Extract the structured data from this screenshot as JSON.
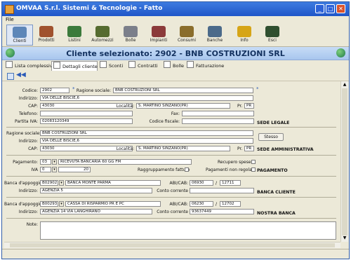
{
  "window": {
    "title": "OMVAA S.r.l. Sistemi & Tecnologie - Fatto"
  },
  "menu": {
    "file": "File"
  },
  "toolbar": {
    "items": [
      {
        "label": "Clienti",
        "icon": "clients-icon",
        "color": "#5d86b8"
      },
      {
        "label": "Prodotti",
        "icon": "products-icon",
        "color": "#a0522d"
      },
      {
        "label": "Listini",
        "icon": "price-lists-icon",
        "color": "#3b7a3b"
      },
      {
        "label": "Automezzi",
        "icon": "vehicles-icon",
        "color": "#556b2f"
      },
      {
        "label": "Bolle",
        "icon": "delivery-notes-icon",
        "color": "#7b7f8a"
      },
      {
        "label": "Impianti",
        "icon": "plants-icon",
        "color": "#8b3a3a"
      },
      {
        "label": "Consumi",
        "icon": "consumption-icon",
        "color": "#8a6d2b"
      },
      {
        "label": "Banche",
        "icon": "banks-icon",
        "color": "#4b6a8a"
      },
      {
        "label": "Info",
        "icon": "help-icon",
        "color": "#d6a517"
      },
      {
        "label": "Esci",
        "icon": "exit-icon",
        "color": "#2f4f2f"
      }
    ]
  },
  "banner": {
    "title": "Cliente selezionato:    2902 - BNB COSTRUZIONI SRL"
  },
  "tabs": [
    {
      "label": "Lista complessiva"
    },
    {
      "label": "Dettagli cliente"
    },
    {
      "label": "Sconti"
    },
    {
      "label": "Contratti"
    },
    {
      "label": "Bolle"
    },
    {
      "label": "Fatturazione"
    }
  ],
  "form": {
    "codice_label": "Codice:",
    "codice": "2902",
    "ragione_label": "Ragione sociale:",
    "ragione": "BNB COSTRUZIONI SRL",
    "indirizzo_label": "Indirizzo:",
    "indirizzo": "VIA DELLE BISCIE,6",
    "cap_label": "CAP:",
    "cap": "43030",
    "localita_label": "Località:",
    "localita": "S. MARTINO SINZANO(PR)",
    "pr_label": "Pr.",
    "pr": "PR",
    "telefono_label": "Telefono:",
    "telefono": "",
    "fax_label": "Fax:",
    "fax": "",
    "piva_label": "Partita IVA:",
    "piva": "02083120349",
    "cf_label": "Codice fiscale:",
    "cf": "",
    "sede_legale": "SEDE LEGALE",
    "amm_ragione": "BNB COSTRUZIONI SRL",
    "amm_indirizzo": "VIA DELLE BISCIE,6",
    "amm_cap": "43030",
    "amm_localita": "S. MARTINO SINZANO(PR)",
    "amm_pr": "PR",
    "stesso_button": "Stesso",
    "sede_amm": "SEDE AMMINISTRATIVA",
    "pagamento_label": "Pagamento:",
    "pagamento_code": "03",
    "pagamento_desc": "RICEVUTA BANCARIA 60 GG FM",
    "recupero_label": "Recupero spese",
    "iva_label": "IVA",
    "iva_code": "0",
    "iva_value": "20",
    "raggruppamento_label": "Raggruppamento fatture",
    "pagamenti_nr_label": "Pagamenti non regolari",
    "pagamento_section": "PAGAMENTO",
    "banca_label": "Banca d'appoggio:",
    "banca_code": "B02902",
    "banca_name": "BANCA MONTE PARMA",
    "abi_label": "ABI/CAB:",
    "banca_abi": "06930",
    "banca_cab": "12711",
    "indirizzo_banca": "AGENZIA 5",
    "conto_label": "Conto corrente",
    "banca_cliente": "BANCA CLIENTE",
    "nostra_code": "B00293",
    "nostra_name": "CASSA DI RISPARMIO PR E PC",
    "nostra_abi": "06230",
    "nostra_cab": "12702",
    "nostra_indirizzo": "AGENZIA 14 VIA LANGHIRANO",
    "nostra_conto": "93637449",
    "nostra_banca": "NOSTRA BANCA",
    "note_label": "Note:"
  }
}
